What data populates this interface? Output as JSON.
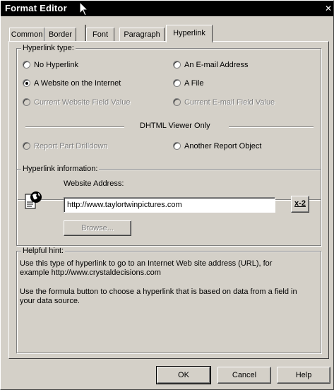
{
  "window": {
    "title": "Format Editor",
    "close_glyph": "✕"
  },
  "tabs": [
    {
      "label": "Common",
      "active": false
    },
    {
      "label": "Border",
      "active": false
    },
    {
      "label": "Font",
      "active": false
    },
    {
      "label": "Paragraph",
      "active": false
    },
    {
      "label": "Hyperlink",
      "active": true
    }
  ],
  "hyperlink_type": {
    "group_label": "Hyperlink type:",
    "options": {
      "no_hyperlink": {
        "label": "No Hyperlink",
        "checked": false,
        "enabled": true
      },
      "website": {
        "label": "A Website on the Internet",
        "checked": true,
        "enabled": true
      },
      "website_field": {
        "label": "Current Website Field Value",
        "checked": false,
        "enabled": false
      },
      "email": {
        "label": "An E-mail Address",
        "checked": false,
        "enabled": true
      },
      "file": {
        "label": "A File",
        "checked": false,
        "enabled": true
      },
      "email_field": {
        "label": "Current E-mail Field Value",
        "checked": false,
        "enabled": false
      },
      "report_part": {
        "label": "Report Part Drilldown",
        "checked": false,
        "enabled": false
      },
      "another_report": {
        "label": "Another Report Object",
        "checked": false,
        "enabled": true
      }
    },
    "dhtml_label": "DHTML Viewer Only"
  },
  "hyperlink_info": {
    "group_label": "Hyperlink information:",
    "address_label": "Website Address:",
    "address_value": "http://www.taylortwinpictures.com",
    "formula_glyph": "x-2",
    "browse_label": "Browse..."
  },
  "helpful_hint": {
    "group_label": "Helpful hint:",
    "line1": "Use this type of hyperlink to go to an Internet Web site address (URL), for",
    "line2": "example http://www.crystaldecisions.com",
    "line3": "Use the formula button to choose a hyperlink that is based on data from a field in",
    "line4": "your data source."
  },
  "footer": {
    "ok_label": "OK",
    "cancel_label": "Cancel",
    "help_label": "Help"
  }
}
